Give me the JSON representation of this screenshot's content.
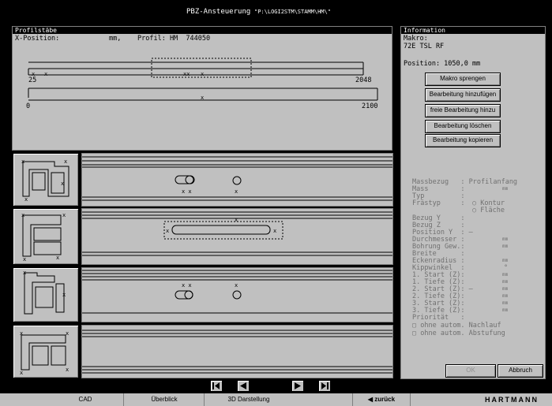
{
  "titlebar": {
    "title": "PBZ-Ansteuerung",
    "path": "\"P:\\LOGI2STM\\STAMM\\HM\\\""
  },
  "profile_panel": {
    "header": "Profilstäbe",
    "xpos_label": "X-Position:",
    "xpos_unit": "mm,",
    "profil_label": "Profil: HM  744050",
    "scale1_left": "25",
    "scale1_right": "2048",
    "scale2_left": "0",
    "scale2_right": "2100"
  },
  "info_panel": {
    "header": "Information",
    "makro_label": "Makro:",
    "makro_value": "72E TSL RF",
    "position": "Position: 1050,0 mm",
    "buttons": [
      {
        "label": "Makro sprengen"
      },
      {
        "label": "Bearbeitung hinzufügen"
      },
      {
        "label": "freie Bearbeitung hinzu"
      },
      {
        "label": "Bearbeitung löschen"
      },
      {
        "label": "Bearbeitung kopieren"
      }
    ],
    "fields": {
      "massbezug": "Massbezug   : Profilanfang",
      "mass": "Mass        :",
      "mass_unit": "mm",
      "typ": "Typ         :",
      "fraestyp": "Frästyp     :",
      "opt_kontur": "Kontur",
      "opt_flaeche": "Fläche",
      "bezug_y": "Bezug Y     :",
      "bezug_z": "Bezug Z     :",
      "position_y": "Position Y  : –",
      "durchmesser": "Durchmesser :",
      "bohrung": "Bohrung Gew.:",
      "breite": "Breite      :",
      "eckenradius": "Eckenradius :",
      "kippwinkel": "Kippwinkel  :",
      "deg": "°",
      "start1": "1. Start (Z):",
      "tiefe1": "1. Tiefe (Z):",
      "start2": "2. Start (Z): –",
      "tiefe2": "2. Tiefe (Z):",
      "start3": "3. Start (Z):",
      "tiefe3": "3. Tiefe (Z):",
      "prioritaet": "Priorität   :",
      "chk1": "ohne autom. Nachlauf",
      "chk2": "ohne autom. Abstufung",
      "mm": "mm"
    },
    "ok": "OK",
    "abbruch": "Abbruch"
  },
  "bottom": {
    "tabs": [
      "CAD",
      "Überblick",
      "3D Darstellung"
    ],
    "back": "zurück",
    "brand": "HARTMANN"
  }
}
